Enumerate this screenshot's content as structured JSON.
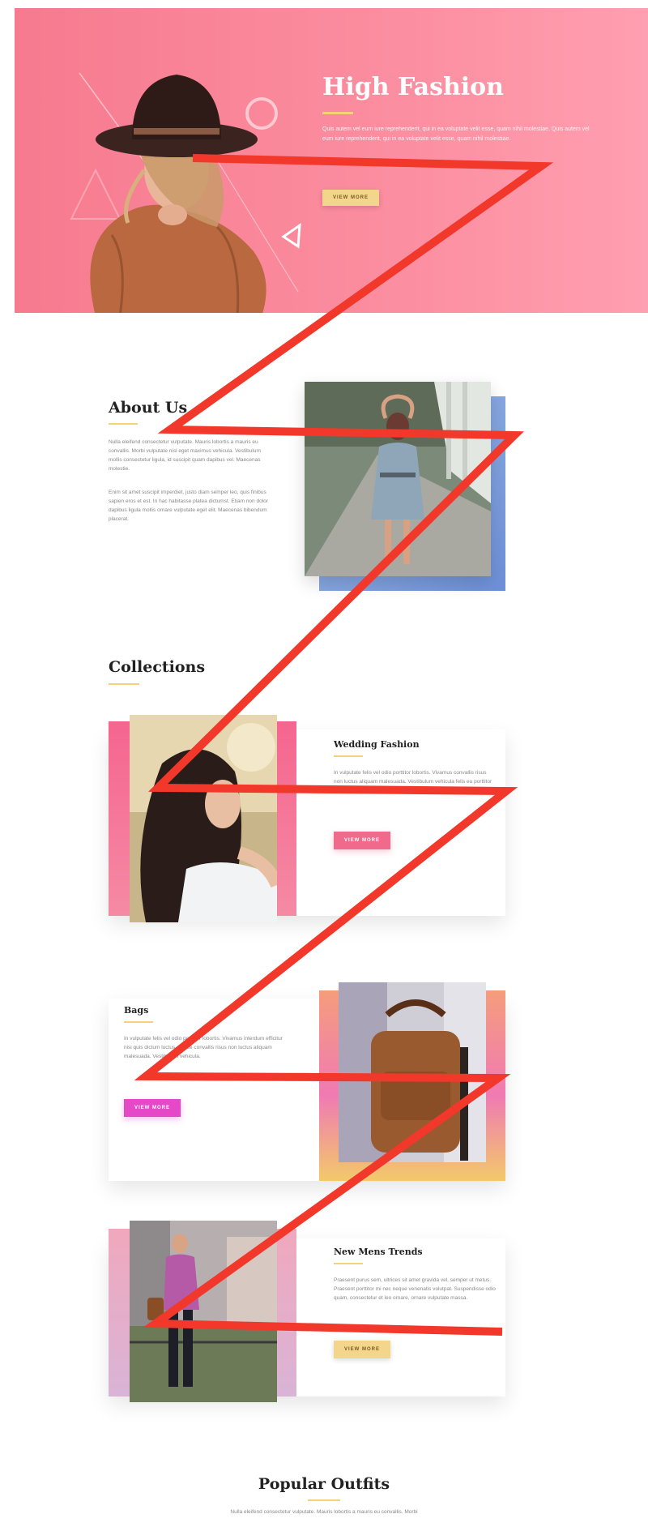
{
  "hero": {
    "title": "High Fashion",
    "text": "Quis autem vel eum iure reprehenderit, qui in ea voluptate velit esse, quam nihil molestiae. Quis autem vel eum iure reprehenderit, qui in ea voluptate velit esse, quam nihil molestiae.",
    "button": "VIEW MORE"
  },
  "about": {
    "title": "About Us",
    "p1": "Nulla eleifend consectetur vulputate. Mauris lobortis a mauris eu convallis. Morbi vulputate nisl eget maximus vehicula. Vestibulum mollis consectetur ligula, id suscipit quam dapibus vel. Maecenas molestie.",
    "p2": "Enim sit amet suscipit imperdiet, justo diam semper leo, quis finibus sapien eros et est. In hac habitasse platea dictumst. Etiam non dolor dapibus ligula mollis ornare vulputate eget elit. Maecenas bibendum placerat."
  },
  "collections": {
    "title": "Collections",
    "items": [
      {
        "title": "Wedding Fashion",
        "text": "In vulputate felis vel odio porttitor lobortis. Vivamus convallis risus non luctus aliquam malesuada. Vestibulum vehicula felis eu porttitor viverra.",
        "button": "VIEW MORE"
      },
      {
        "title": "Bags",
        "text": "In vulputate felis vel odio porttitor lobortis. Vivamus interdum efficitur nisi quis dictum luctus. Fusce convallis risus non luctus aliquam malesuada. Vestibulum vehicula.",
        "button": "VIEW MORE"
      },
      {
        "title": "New Mens Trends",
        "text": "Praesent purus sem, ultrices sit amet gravida vel, semper ut metus. Praesent porttitor mi nec neque venenatis volutpat. Suspendisse odio quam, consectetur et leo ornare, ornare vulputate massa.",
        "button": "VIEW MORE"
      }
    ]
  },
  "popular": {
    "title": "Popular Outfits",
    "text": "Nulla eleifend consectetur vulputate. Mauris lobortis a mauris eu convallis. Morbi"
  },
  "colors": {
    "hero_pink": "#f77a8f",
    "gold": "#f4d27b",
    "overlay_red": "#f2372b"
  }
}
